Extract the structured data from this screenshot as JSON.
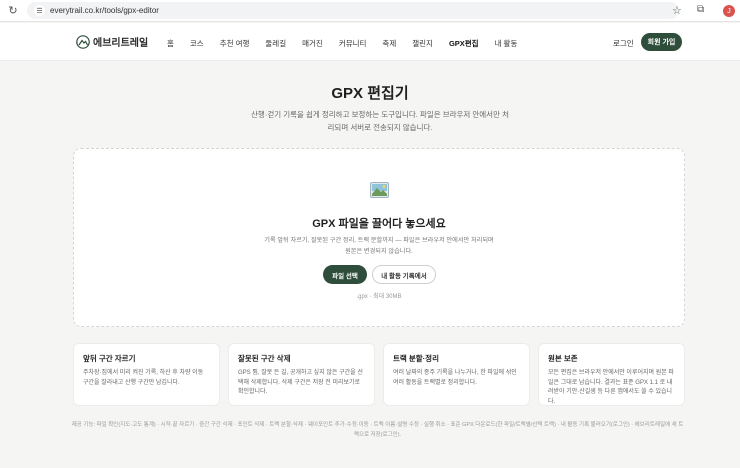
{
  "browser": {
    "url": "everytrail.co.kr/tools/gpx-editor",
    "profile_initial": "J"
  },
  "header": {
    "logo_text": "에브리트레일",
    "nav": [
      "홈",
      "코스",
      "추천 여행",
      "둘레길",
      "매거진",
      "커뮤니티",
      "축제",
      "챌린지",
      "GPX편집",
      "내 활동"
    ],
    "active_nav_index": 8,
    "login": "로그인",
    "signup": "회원 가입"
  },
  "hero": {
    "title": "GPX 편집기",
    "description": "산행·걷기 기록을 쉽게 정리하고 보정하는 도구입니다. 파일은 브라우저 안에서만 처리되며 서버로 전송되지 않습니다."
  },
  "dropzone": {
    "title": "GPX 파일을 끌어다 놓으세요",
    "description": "기록 앞뒤 자르기, 잘못된 구간 정리, 트랙 분할까지 — 파일은 브라우저 안에서만 처리되며 원본은 변경되지 않습니다.",
    "primary_button": "파일 선택",
    "secondary_button": "내 활동 기록에서",
    "hint": ".gpx · 최대 30MB"
  },
  "features": [
    {
      "title": "앞뒤 구간 자르기",
      "desc": "주차장·집에서 미리 켜진 기록, 하산 후 차량 이동 구간을 잘라내고 산행 구간만 남깁니다."
    },
    {
      "title": "잘못된 구간 삭제",
      "desc": "GPS 튐, 잘못 든 길, 공개하고 싶지 않은 구간을 선택해 삭제합니다. 삭제 구간은 저장 전 미리보기로 확인합니다."
    },
    {
      "title": "트랙 분할·정리",
      "desc": "여러 날짜의 종주 기록을 나누거나, 한 파일에 섞인 여러 활동을 트랙별로 정리합니다."
    },
    {
      "title": "원본 보존",
      "desc": "모든 편집은 브라우저 안에서만 이루어지며 원본 파일은 그대로 남습니다. 결과는 표준 GPX 1.1 로 내려받아 기안·산길샘 등 다른 앱에서도 쓸 수 있습니다."
    }
  ],
  "footer": "제공 기능: 파일 확인(지도·고도 통계) · 시작·끝 자르기 · 중간 구간 삭제 · 포인트 삭제 · 트랙 분할·삭제 · 웨이포인트 추가·수정·이동 · 트랙 이름·설명 수정 · 실행 취소 · 표준 GPX 다운로드(한 파일/트랙별/선택 트랙) · 내 활동 기록 불러오기(로그인) · 에브리트레일에 새 트랙으로 저장(로그인).",
  "colors": {
    "brand": "#2f4d3b",
    "background": "#f5f5f3"
  }
}
